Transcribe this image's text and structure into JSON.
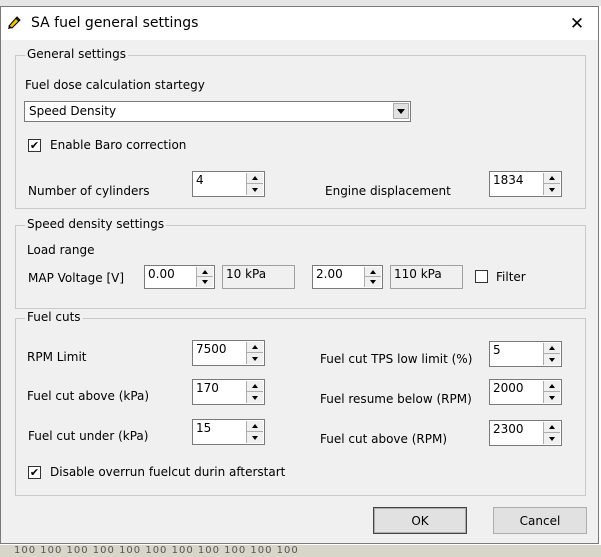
{
  "window": {
    "title": "SA fuel general settings"
  },
  "general": {
    "group_label": "General settings",
    "calc_label": "Fuel dose calculation startegy",
    "calc_value": "Speed Density",
    "baro_label": "Enable Baro correction",
    "baro_checked": "✔",
    "cyl_label": "Number of cylinders",
    "cyl_value": "4",
    "disp_label": "Engine displacement",
    "disp_value": "1834"
  },
  "speed_density": {
    "group_label": "Speed density settings",
    "load_label": "Load range",
    "map_label": "MAP Voltage [V]",
    "min_voltage": "0.00",
    "min_kpa": "10 kPa",
    "max_voltage": "2.00",
    "max_kpa": "110 kPa",
    "filter_label": "Filter"
  },
  "fuel_cuts": {
    "group_label": "Fuel cuts",
    "rpm_limit_label": "RPM Limit",
    "rpm_limit_value": "7500",
    "cut_above_kpa_label": "Fuel cut above (kPa)",
    "cut_above_kpa_value": "170",
    "cut_under_kpa_label": "Fuel cut under (kPa)",
    "cut_under_kpa_value": "15",
    "tps_low_label": "Fuel cut TPS low limit (%)",
    "tps_low_value": "5",
    "resume_below_label": "Fuel resume below (RPM)",
    "resume_below_value": "2000",
    "cut_above_rpm_label": "Fuel cut above (RPM)",
    "cut_above_rpm_value": "2300",
    "overrun_label": "Disable overrun fuelcut durin afterstart",
    "overrun_checked": "✔"
  },
  "buttons": {
    "ok": "OK",
    "cancel": "Cancel"
  },
  "background": {
    "bottom_strip": "100 100 100 100 100 100 100 100 100 100 100"
  }
}
